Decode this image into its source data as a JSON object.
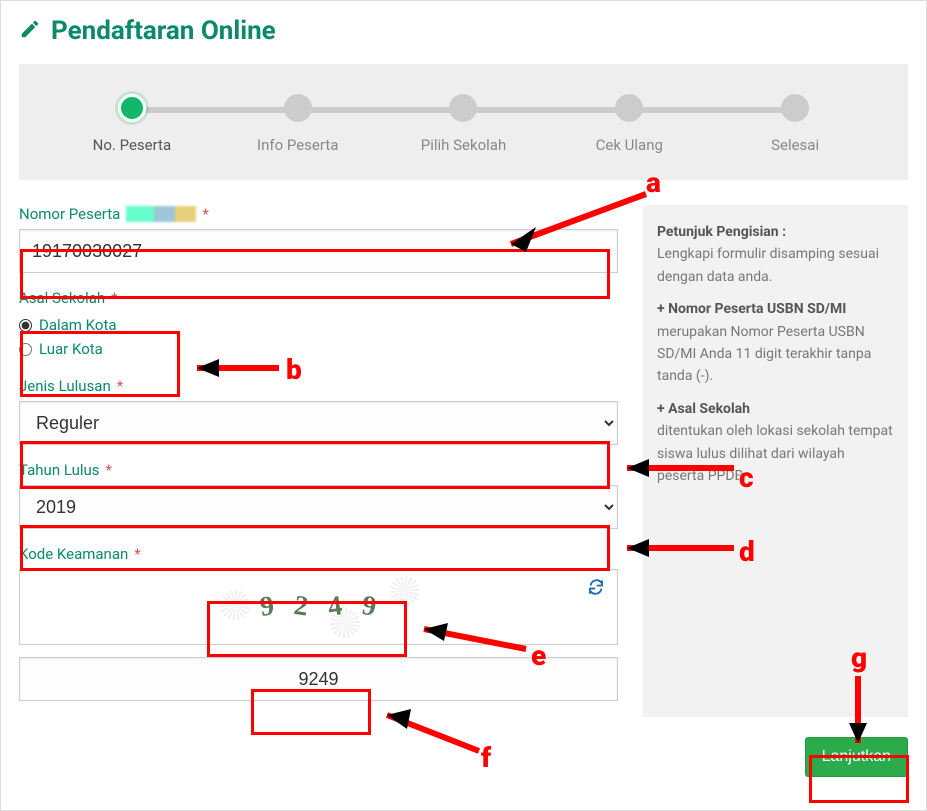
{
  "page": {
    "title": "Pendaftaran Online"
  },
  "stepper": {
    "steps": [
      {
        "label": "No. Peserta",
        "active": true
      },
      {
        "label": "Info Peserta",
        "active": false
      },
      {
        "label": "Pilih Sekolah",
        "active": false
      },
      {
        "label": "Cek Ulang",
        "active": false
      },
      {
        "label": "Selesai",
        "active": false
      }
    ]
  },
  "form": {
    "nomor": {
      "label": "Nomor Peserta",
      "value": "19170030027"
    },
    "asal": {
      "label": "Asal Sekolah",
      "options": [
        {
          "value": "dalam",
          "label": "Dalam Kota",
          "checked": true
        },
        {
          "value": "luar",
          "label": "Luar Kota",
          "checked": false
        }
      ]
    },
    "lulusan": {
      "label": "Jenis Lulusan",
      "value": "Reguler"
    },
    "tahun": {
      "label": "Tahun Lulus",
      "value": "2019"
    },
    "captcha": {
      "label": "Kode Keamanan",
      "image_digits": [
        "9",
        "2",
        "4",
        "9"
      ],
      "input_value": "9249"
    },
    "submit_label": "Lanjutkan",
    "required_mark": "*"
  },
  "help": {
    "title": "Petunjuk Pengisian :",
    "body": "Lengkapi formulir disamping sesuai dengan data anda.",
    "item1_heading": "+ Nomor Peserta USBN SD/MI",
    "item1_body": "merupakan Nomor Peserta USBN SD/MI Anda 11 digit terakhir tanpa tanda (-).",
    "item2_heading": "+ Asal Sekolah",
    "item2_body": "ditentukan oleh lokasi sekolah tempat siswa lulus dilihat dari wilayah peserta PPDB."
  },
  "annotations": {
    "a": "a",
    "b": "b",
    "c": "c",
    "d": "d",
    "e": "e",
    "f": "f",
    "g": "g"
  }
}
